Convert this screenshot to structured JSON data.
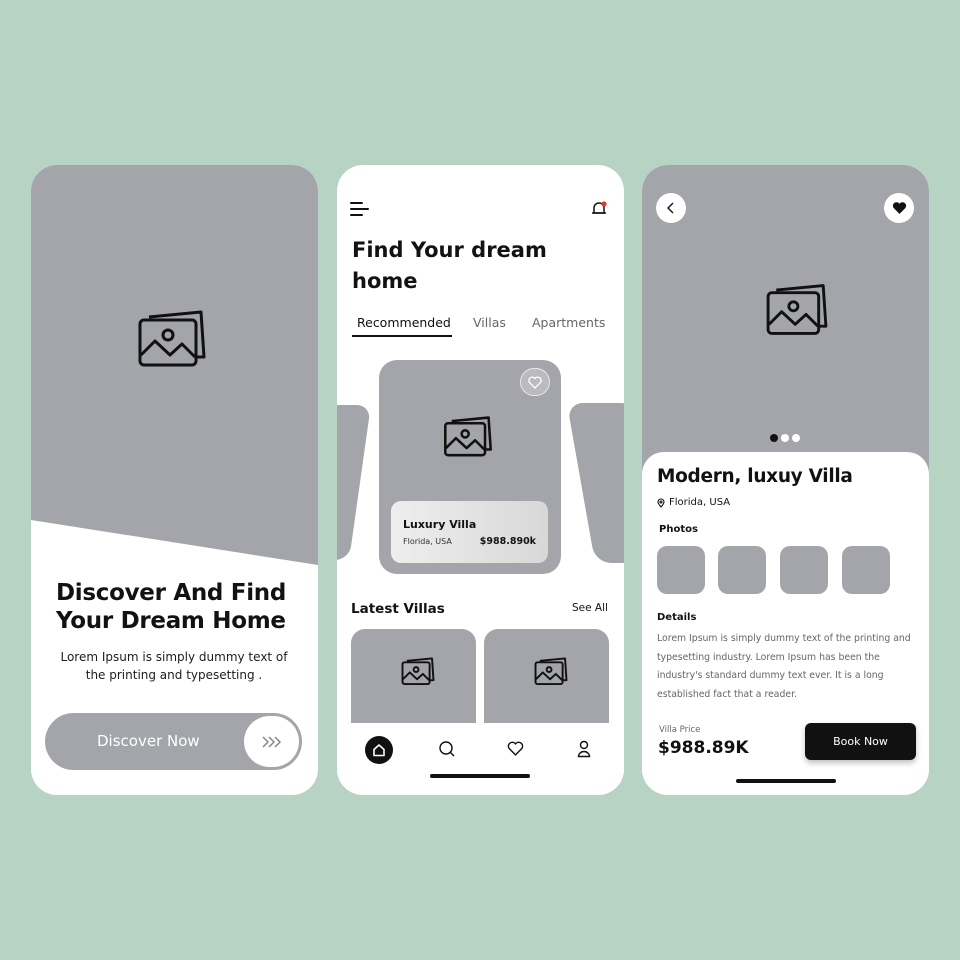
{
  "colors": {
    "background": "#b6d3c4",
    "placeholder_gray": "#a4a5aa",
    "text_dark": "#121212",
    "button_dark": "#111111"
  },
  "onboarding": {
    "hero_image_icon": "image-placeholder-icon",
    "headline": "Discover And Find Your Dream Home",
    "description": "Lorem Ipsum is simply dummy text of the printing and typesetting .",
    "cta_label": "Discover Now",
    "cta_icon": "triple-chevron-right-icon"
  },
  "home": {
    "menu_icon": "menu-icon",
    "notification_icon": "bell-icon",
    "title": "Find  Your dream home",
    "tabs": [
      {
        "label": "Recommended",
        "active": true
      },
      {
        "label": "Villas",
        "active": false
      },
      {
        "label": "Apartments",
        "active": false
      }
    ],
    "featured": {
      "name": "Luxury Villa",
      "location": "Florida, USA",
      "price": "$988.890k"
    },
    "latest_title": "Latest Villas",
    "see_all": "See All",
    "nav": [
      "home-icon",
      "search-icon",
      "heart-icon",
      "user-icon"
    ]
  },
  "detail": {
    "carousel": {
      "count": 3,
      "active": 1
    },
    "title": "Modern, luxuy Villa",
    "location": "Florida, USA",
    "photos_label": "Photos",
    "details_label": "Details",
    "details_text": "Lorem Ipsum is simply dummy text of the printing and typesetting industry. Lorem Ipsum has been the industry's standard dummy text ever. It is a long established fact that a reader.",
    "price_label": "Villa Price",
    "price": "$988.89K",
    "book_label": "Book Now"
  }
}
